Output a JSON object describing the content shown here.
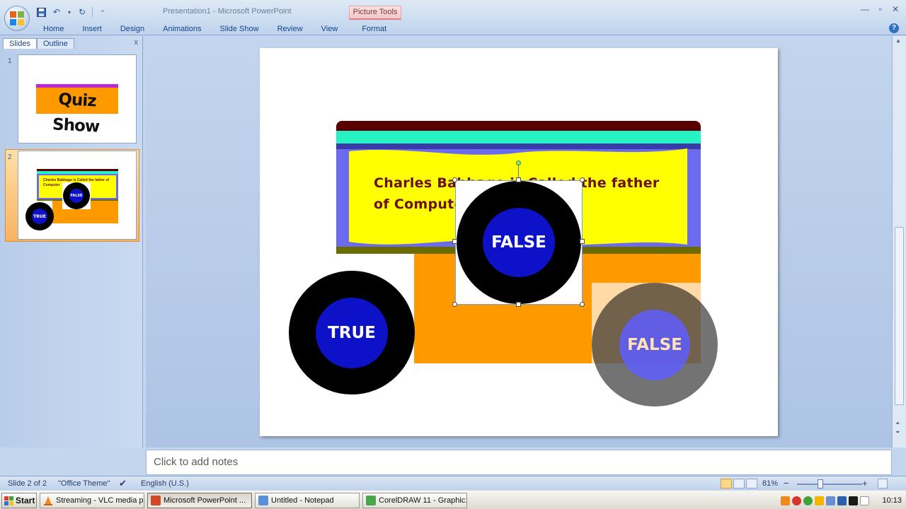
{
  "window": {
    "title": "Presentation1 - Microsoft PowerPoint",
    "contextual_tab": "Picture Tools",
    "controls": [
      "—",
      "▫",
      "✕"
    ]
  },
  "ribbon": {
    "tabs": [
      "Home",
      "Insert",
      "Design",
      "Animations",
      "Slide Show",
      "Review",
      "View"
    ],
    "format_tab": "Format"
  },
  "slides_pane": {
    "tabs": [
      "Slides",
      "Outline"
    ],
    "close": "x",
    "slides": [
      {
        "number": "1",
        "title": "Quiz Show"
      },
      {
        "number": "2",
        "question": "Charles Babbage is Called the father of Computer",
        "true_label": "TRUE",
        "false_label": "FALSE"
      }
    ]
  },
  "slide": {
    "question_line1": "Charles Babbage is Called the father",
    "question_line2": "of Computer",
    "answers": {
      "true_label": "TRUE",
      "false_label_selected": "FALSE",
      "false_label_faded": "FALSE"
    }
  },
  "notes": {
    "placeholder": "Click to add notes"
  },
  "statusbar": {
    "slide_counter": "Slide 2 of 2",
    "theme": "\"Office Theme\"",
    "language": "English (U.S.)",
    "zoom": "81%",
    "zoom_minus": "−",
    "zoom_plus": "+"
  },
  "taskbar": {
    "start": "Start",
    "items": [
      {
        "label": "Streaming - VLC media pl...",
        "icon_color": "#f08a1c"
      },
      {
        "label": "Microsoft PowerPoint ...",
        "icon_color": "#d24726",
        "active": true
      },
      {
        "label": "Untitled - Notepad",
        "icon_color": "#5b8fd9"
      },
      {
        "label": "CorelDRAW 11 - Graphic1",
        "icon_color": "#4aa64a"
      }
    ],
    "clock": "10:13"
  },
  "colors": {
    "slide_yellow": "#ffff00",
    "slide_orange": "#ff9900",
    "slide_periwinkle": "#6b6bf0",
    "wheel_hub_blue": "#0d12c9",
    "question_text": "#6b0f12"
  }
}
